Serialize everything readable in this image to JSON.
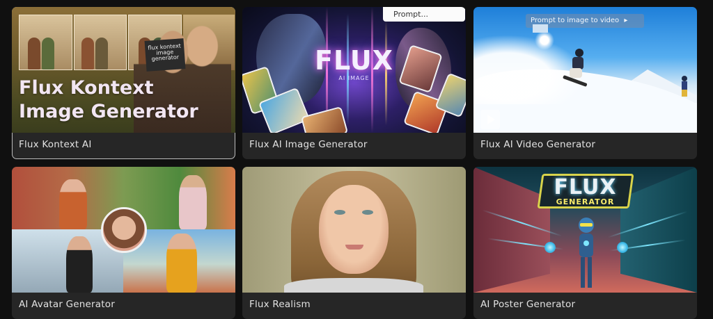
{
  "cards": [
    {
      "label": "Flux Kontext AI",
      "art_title_line1": "Flux Kontext",
      "art_title_line2": "Image Generator",
      "sign_text": "flux kontext image generator"
    },
    {
      "label": "Flux AI Image Generator",
      "art_title": "FLUX",
      "art_subtitle": "AI IMAGE",
      "prompt_chip": "Prompt..."
    },
    {
      "label": "Flux AI Video Generator",
      "badge": "Prompt to image to video"
    },
    {
      "label": "AI Avatar Generator"
    },
    {
      "label": "Flux Realism"
    },
    {
      "label": "AI Poster Generator",
      "logo_title": "FLUX",
      "logo_sub": "GENERATOR"
    }
  ],
  "icons": {
    "play": "play-icon",
    "badge_arrow": "play-arrow-icon"
  }
}
